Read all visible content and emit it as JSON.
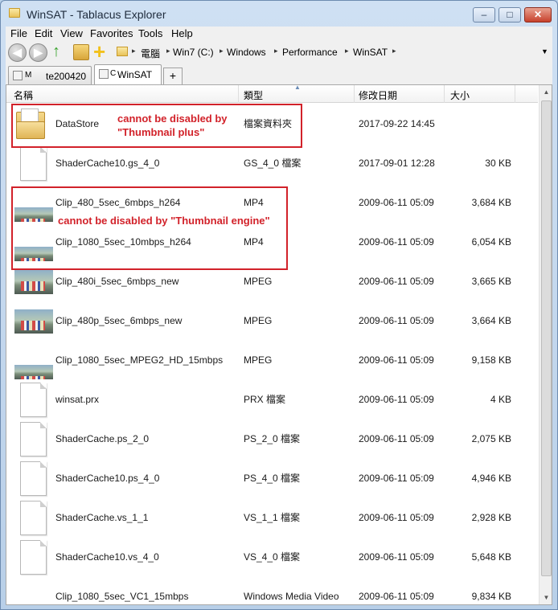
{
  "window": {
    "title": "WinSAT - Tablacus Explorer",
    "minimize": "–",
    "maximize": "□",
    "close": "✕"
  },
  "menu": [
    {
      "label": "File"
    },
    {
      "label": "Edit"
    },
    {
      "label": "View"
    },
    {
      "label": "Favorites"
    },
    {
      "label": "Tools"
    },
    {
      "label": "Help"
    }
  ],
  "toolbar": {
    "back": "◀",
    "forward": "▶",
    "up": "↑",
    "new": "+",
    "dropdown": "▼"
  },
  "address": {
    "separator": "▸",
    "segments": [
      "電腦",
      "Win7 (C:)",
      "Windows",
      "Performance",
      "WinSAT"
    ]
  },
  "tabs": [
    {
      "icon": "folder-icon",
      "prefix": "M",
      "label": "te200420"
    },
    {
      "icon": "folder-icon",
      "prefix": "C",
      "label": "WinSAT",
      "active": true
    }
  ],
  "tab_add": "+",
  "columns": {
    "name": "名稱",
    "type": "類型",
    "date": "修改日期",
    "size": "大小",
    "sort_indicator": "▲"
  },
  "files": [
    {
      "icon": "folder",
      "name": "DataStore",
      "type": "檔案資料夾",
      "date": "2017-09-22 14:45",
      "size": ""
    },
    {
      "icon": "document",
      "name": "ShaderCache10.gs_4_0",
      "type": "GS_4_0 檔案",
      "date": "2017-09-01 12:28",
      "size": "30 KB"
    },
    {
      "icon": "video-short",
      "name": "Clip_480_5sec_6mbps_h264",
      "type": "MP4",
      "date": "2009-06-11 05:09",
      "size": "3,684 KB"
    },
    {
      "icon": "video-short",
      "name": "Clip_1080_5sec_10mbps_h264",
      "type": "MP4",
      "date": "2009-06-11 05:09",
      "size": "6,054 KB"
    },
    {
      "icon": "video",
      "name": "Clip_480i_5sec_6mbps_new",
      "type": "MPEG",
      "date": "2009-06-11 05:09",
      "size": "3,665 KB"
    },
    {
      "icon": "video",
      "name": "Clip_480p_5sec_6mbps_new",
      "type": "MPEG",
      "date": "2009-06-11 05:09",
      "size": "3,664 KB"
    },
    {
      "icon": "video-short",
      "name": "Clip_1080_5sec_MPEG2_HD_15mbps",
      "type": "MPEG",
      "date": "2009-06-11 05:09",
      "size": "9,158 KB"
    },
    {
      "icon": "document",
      "name": "winsat.prx",
      "type": "PRX 檔案",
      "date": "2009-06-11 05:09",
      "size": "4 KB"
    },
    {
      "icon": "document",
      "name": "ShaderCache.ps_2_0",
      "type": "PS_2_0 檔案",
      "date": "2009-06-11 05:09",
      "size": "2,075 KB"
    },
    {
      "icon": "document",
      "name": "ShaderCache10.ps_4_0",
      "type": "PS_4_0 檔案",
      "date": "2009-06-11 05:09",
      "size": "4,946 KB"
    },
    {
      "icon": "document",
      "name": "ShaderCache.vs_1_1",
      "type": "VS_1_1 檔案",
      "date": "2009-06-11 05:09",
      "size": "2,928 KB"
    },
    {
      "icon": "document",
      "name": "ShaderCache10.vs_4_0",
      "type": "VS_4_0 檔案",
      "date": "2009-06-11 05:09",
      "size": "5,648 KB"
    },
    {
      "icon": "video-clipped",
      "name": "Clip_1080_5sec_VC1_15mbps",
      "type": "Windows Media Video",
      "date": "2009-06-11 05:09",
      "size": "9,834 KB"
    }
  ],
  "annotations": {
    "thumbnail_plus_line1": "cannot be disabled by",
    "thumbnail_plus_line2": "\"Thumbnail plus\"",
    "thumbnail_engine": "cannot be disabled by \"Thumbnail engine\"",
    "color": "#d2222a"
  },
  "scrollbar": {
    "up": "▲",
    "down": "▼"
  }
}
